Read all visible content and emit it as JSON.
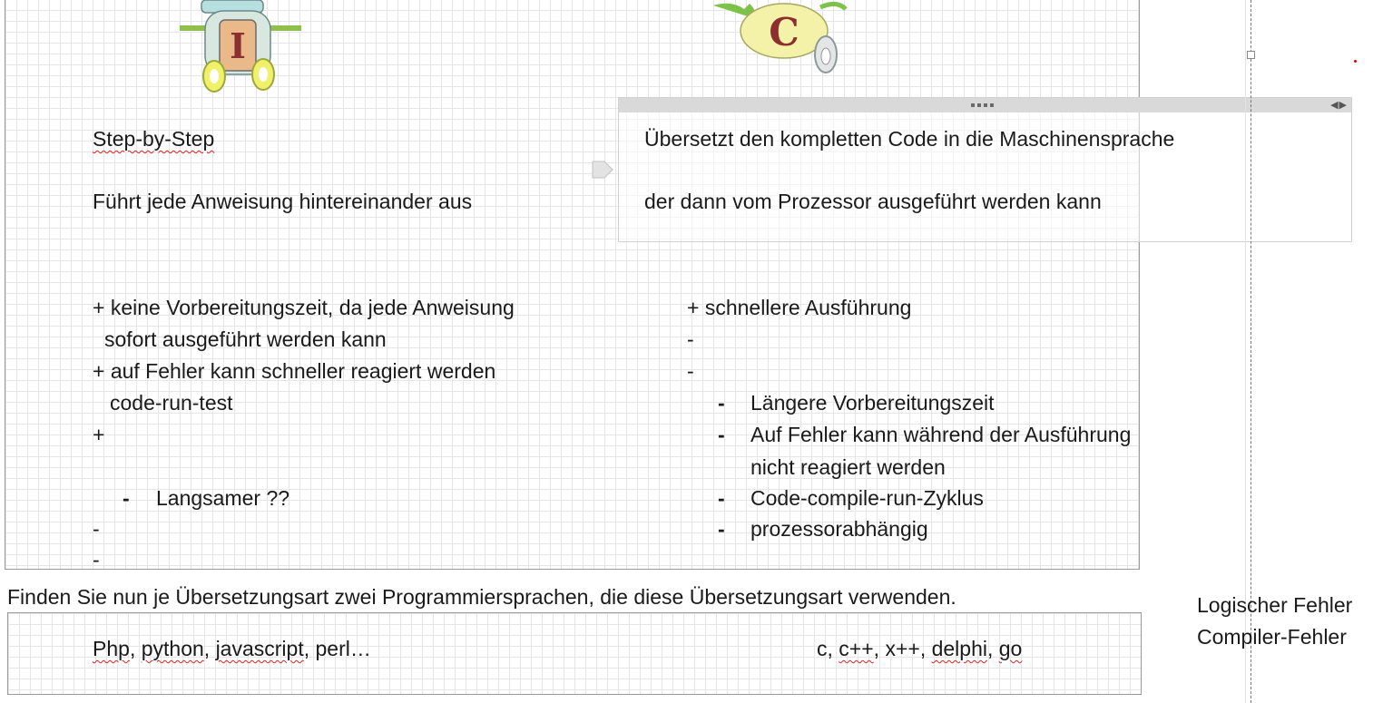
{
  "interpreter": {
    "title": "Step-by-Step",
    "desc": "Führt jede Anweisung hintereinander aus",
    "pro1": "+ keine Vorbereitungszeit, da jede Anweisung",
    "pro1b": "sofort ausgeführt werden kann",
    "pro2": "+ auf Fehler kann schneller reagiert werden",
    "pro2b": "code-run-test",
    "plus": "+",
    "con1": "Langsamer ??",
    "dash1": "-",
    "dash2": "-"
  },
  "compiler": {
    "line1": "Übersetzt den kompletten Code in die Maschinensprache",
    "line2": "der dann vom Prozessor ausgeführt werden kann",
    "pro1": "+ schnellere Ausführung",
    "dash1": "-",
    "dash2": "-",
    "cons": [
      "Längere Vorbereitungszeit",
      "Auf Fehler kann während der Ausführung",
      "nicht reagiert werden",
      "Code-compile-run-Zyklus",
      "prozessorabhängig"
    ]
  },
  "question": "Finden Sie nun je Übersetzungsart zwei Programmiersprachen, die diese Übersetzungsart verwenden.",
  "answer": {
    "interpreted": [
      "Php",
      "python",
      "javascript",
      "perl…"
    ],
    "compiled": [
      "c",
      "c++",
      "x++",
      "delphi",
      "go"
    ]
  },
  "sidenote": {
    "line1": "Logischer Fehler",
    "line2": "Compiler-Fehler"
  },
  "robots": {
    "left_letter": "I",
    "right_letter": "C"
  }
}
